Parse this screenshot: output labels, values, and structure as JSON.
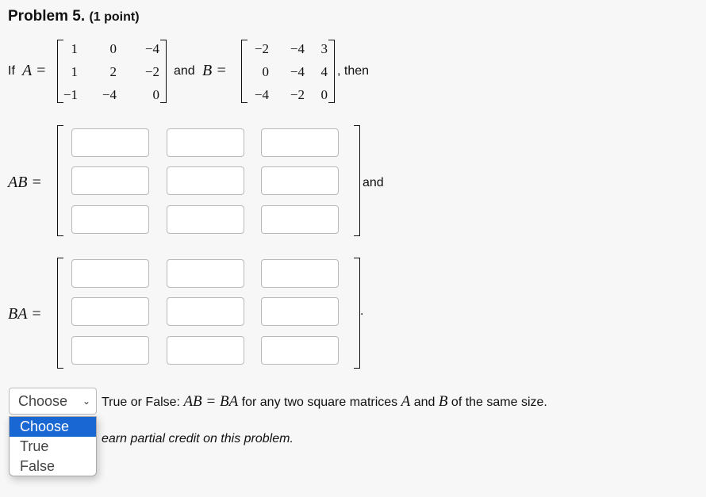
{
  "problem": {
    "title": "Problem 5.",
    "points": "(1 point)"
  },
  "statement": {
    "if_text": "If",
    "A_label": "A =",
    "and_text": "and",
    "B_label": "B =",
    "then_text": ", then",
    "A": [
      [
        "1",
        "0",
        "−4"
      ],
      [
        "1",
        "2",
        "−2"
      ],
      [
        "−1",
        "−4",
        "0"
      ]
    ],
    "B": [
      [
        "−2",
        "−4",
        "3"
      ],
      [
        "0",
        "−4",
        "4"
      ],
      [
        "−4",
        "−2",
        "0"
      ]
    ]
  },
  "AB": {
    "label": "AB =",
    "after": "and",
    "cells": [
      [
        "",
        "",
        ""
      ],
      [
        "",
        "",
        ""
      ],
      [
        "",
        "",
        ""
      ]
    ]
  },
  "BA": {
    "label": "BA =",
    "after": ".",
    "cells": [
      [
        "",
        "",
        ""
      ],
      [
        "",
        "",
        ""
      ],
      [
        "",
        "",
        ""
      ]
    ]
  },
  "question": {
    "select_value": "Choose",
    "options": [
      "Choose",
      "True",
      "False"
    ],
    "text_prefix": "True or False:",
    "math_eq": "AB = BA",
    "text_mid": "for any two square matrices",
    "var_a": "A",
    "and_text": "and",
    "var_b": "B",
    "text_suffix": "of the same size."
  },
  "partial_credit_text": "earn partial credit on this problem.",
  "colors": {
    "highlight": "#1967d2",
    "background": "#f7f7f7"
  }
}
